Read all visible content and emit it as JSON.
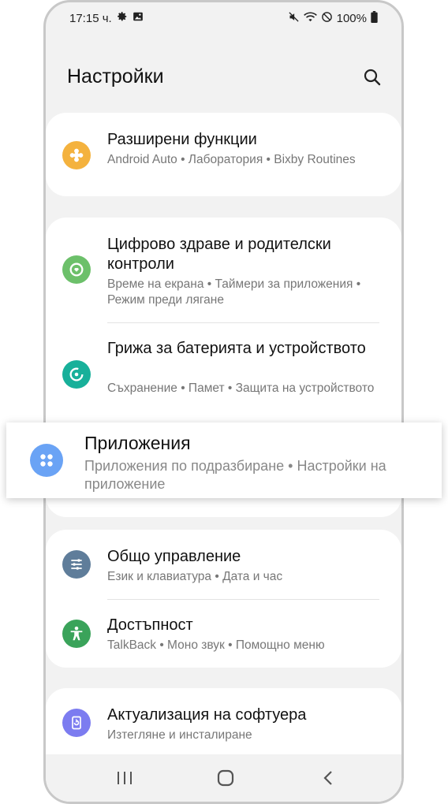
{
  "status": {
    "time": "17:15 ч.",
    "battery": "100%"
  },
  "header": {
    "title": "Настройки"
  },
  "items": [
    {
      "title": "Разширени функции",
      "subtitle": "Android Auto  •  Лаборатория  •  Bixby Routines",
      "color": "#f4b23e"
    },
    {
      "title": "Цифрово здраве и родителски контроли",
      "subtitle": "Време на екрана  •  Таймери за приложения  •  Режим преди лягане",
      "color": "#6cc06a"
    },
    {
      "title": "Грижа за батерията и устройството",
      "subtitle": "Съхранение  •  Памет  •  Защита на устройството",
      "color": "#18b09a"
    },
    {
      "title": "Приложения",
      "subtitle": "Приложения по подразбиране  •  Настройки на приложение",
      "color": "#6aa3f5"
    },
    {
      "title": "Общо управление",
      "subtitle": "Език и клавиатура  •  Дата и час",
      "color": "#5f7d9a"
    },
    {
      "title": "Достъпност",
      "subtitle": "TalkBack  •  Моно звук  •  Помощно меню",
      "color": "#3aa35a"
    },
    {
      "title": "Актуализация на софтуера",
      "subtitle": "Изтегляне и инсталиране",
      "color": "#7c7cf0"
    }
  ]
}
